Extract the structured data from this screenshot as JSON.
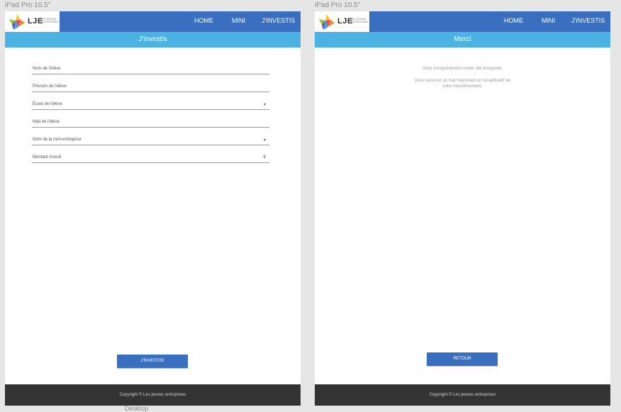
{
  "artboards": [
    {
      "label": "iPad Pro 10.5\"",
      "logo": {
        "text": "LJE",
        "sub": "LES JEUNES ENTREPRISES"
      },
      "nav": [
        "HOME",
        "MINI",
        "J'INVESTIS"
      ],
      "header_title": "J'investis",
      "fields": [
        {
          "label": "Nom de l'élève",
          "suffix": ""
        },
        {
          "label": "Prénom de l'élève",
          "suffix": ""
        },
        {
          "label": "École de l'élève",
          "suffix": "▾"
        },
        {
          "label": "Mail de l'élève",
          "suffix": ""
        },
        {
          "label": "Nom de la mini-entreprise",
          "suffix": "▾"
        },
        {
          "label": "Montant investi",
          "suffix": "€"
        }
      ],
      "button": "J'INVESTIS!",
      "footer": "Copyright © Les jeunes entreprises"
    },
    {
      "label": "iPad Pro 10.5\"",
      "logo": {
        "text": "LJE",
        "sub": "LES JEUNES ENTREPRISES"
      },
      "nav": [
        "HOME",
        "MINI",
        "J'INVESTIS"
      ],
      "header_title": "Merci",
      "messages": [
        "Votre enregistrement à bien été enregistré.",
        "Vous recevrez un mail reprenant un récapitulatif de",
        "votre investissement."
      ],
      "button": "RETOUR",
      "footer": "Copyright © Les jeunes entreprises"
    }
  ],
  "bottom_label": "Desktop",
  "colors": {
    "nav": "#3a6fc0",
    "subheader": "#4bb2e3",
    "footer": "#333333",
    "canvas": "#e6e6e6"
  }
}
